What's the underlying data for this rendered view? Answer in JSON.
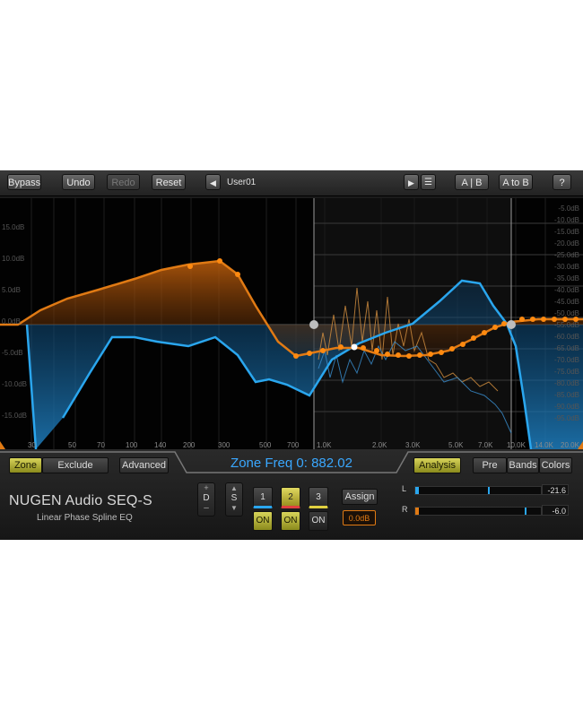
{
  "toolbar": {
    "bypass": "Bypass",
    "undo": "Undo",
    "redo": "Redo",
    "reset": "Reset",
    "preset_name": "User01",
    "ab": "A | B",
    "a_to_b": "A to B",
    "help": "?"
  },
  "graph": {
    "db_left": [
      "15.0dB",
      "10.0dB",
      "5.0dB",
      "0.0dB",
      "-5.0dB",
      "-10.0dB",
      "-15.0dB"
    ],
    "db_right": [
      "-5.0dB",
      "-10.0dB",
      "-15.0dB",
      "-20.0dB",
      "-25.0dB",
      "-30.0dB",
      "-35.0dB",
      "-40.0dB",
      "-45.0dB",
      "-50.0dB",
      "-55.0dB",
      "-60.0dB",
      "-65.0dB",
      "-70.0dB",
      "-75.0dB",
      "-80.0dB",
      "-85.0dB",
      "-90.0dB",
      "-95.0dB"
    ],
    "freq_labels": [
      "30",
      "50",
      "70",
      "100",
      "140",
      "200",
      "300",
      "500",
      "700",
      "1.0K",
      "2.0K",
      "3.0K",
      "5.0K",
      "7.0K",
      "10.0K",
      "14.0K",
      "20.0K"
    ],
    "colors": {
      "orange": "#f07a12",
      "blue": "#2aa6ee",
      "background": "#020202"
    }
  },
  "controls": {
    "zone": "Zone",
    "exclude": "Exclude",
    "advanced": "Advanced",
    "zone_readout": "Zone Freq 0: 882.02",
    "analysis": "Analysis",
    "pre": "Pre",
    "bands": "Bands",
    "colors": "Colors",
    "brand": "NUGEN Audio SEQ-S",
    "subtitle": "Linear Phase Spline EQ",
    "d_toggle": "D",
    "s_toggle": "S",
    "band_buttons": [
      "1",
      "2",
      "3"
    ],
    "on_label": "ON",
    "assign": "Assign",
    "assign_value": "0.0dB",
    "meter_l_label": "L",
    "meter_r_label": "R",
    "meter_l_value": "-21.6",
    "meter_r_value": "-6.0"
  }
}
